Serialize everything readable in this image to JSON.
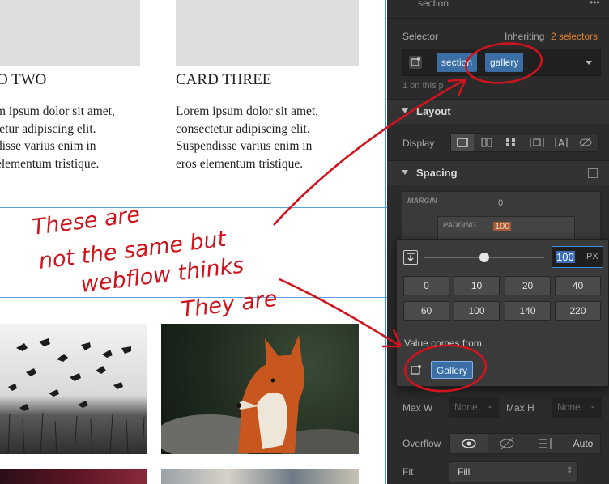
{
  "canvas": {
    "cards": [
      {
        "title": "O TWO",
        "body": "m ipsum dolor sit amet,\ntetur adipiscing elit.\ndisse varius enim in\nelementum tristique."
      },
      {
        "title": "CARD THREE",
        "body": "Lorem ipsum dolor sit amet,\nconsectetur adipiscing elit.\nSuspendisse varius enim in\neros elementum tristique."
      }
    ]
  },
  "panel": {
    "header_title": "section",
    "header_more": "•••",
    "selector_label": "Selector",
    "inheriting_label": "Inheriting",
    "inheriting_count": "2 selectors",
    "selector_tags": [
      "section",
      "gallery"
    ],
    "on_this_page": "1 on this p",
    "layout_title": "Layout",
    "display_label": "Display",
    "spacing_title": "Spacing",
    "margin_label": "MARGIN",
    "margin_value": "0",
    "padding_label": "PADDING",
    "padding_value": "100",
    "maxw_label": "Max W",
    "maxw_value": "None",
    "maxh_label": "Max H",
    "maxh_value": "None",
    "overflow_label": "Overflow",
    "overflow_auto": "Auto",
    "fit_label": "Fit",
    "fit_value": "Fill"
  },
  "popup": {
    "input_value": "100",
    "unit": "PX",
    "slider_fraction": 0.5,
    "presets": [
      "0",
      "10",
      "20",
      "40",
      "60",
      "100",
      "140",
      "220"
    ],
    "value_from_label": "Value comes from:",
    "source_tag": "Gallery"
  },
  "annotation": {
    "lines": [
      "These are",
      "not the same but",
      "webflow thinks",
      "They are"
    ]
  },
  "colors": {
    "accent": "#3d8ee8",
    "tag_bg": "#3a6ea5",
    "inherit": "#e0802f",
    "annotation": "#d0141d",
    "padding_badge": "#c9784a"
  }
}
